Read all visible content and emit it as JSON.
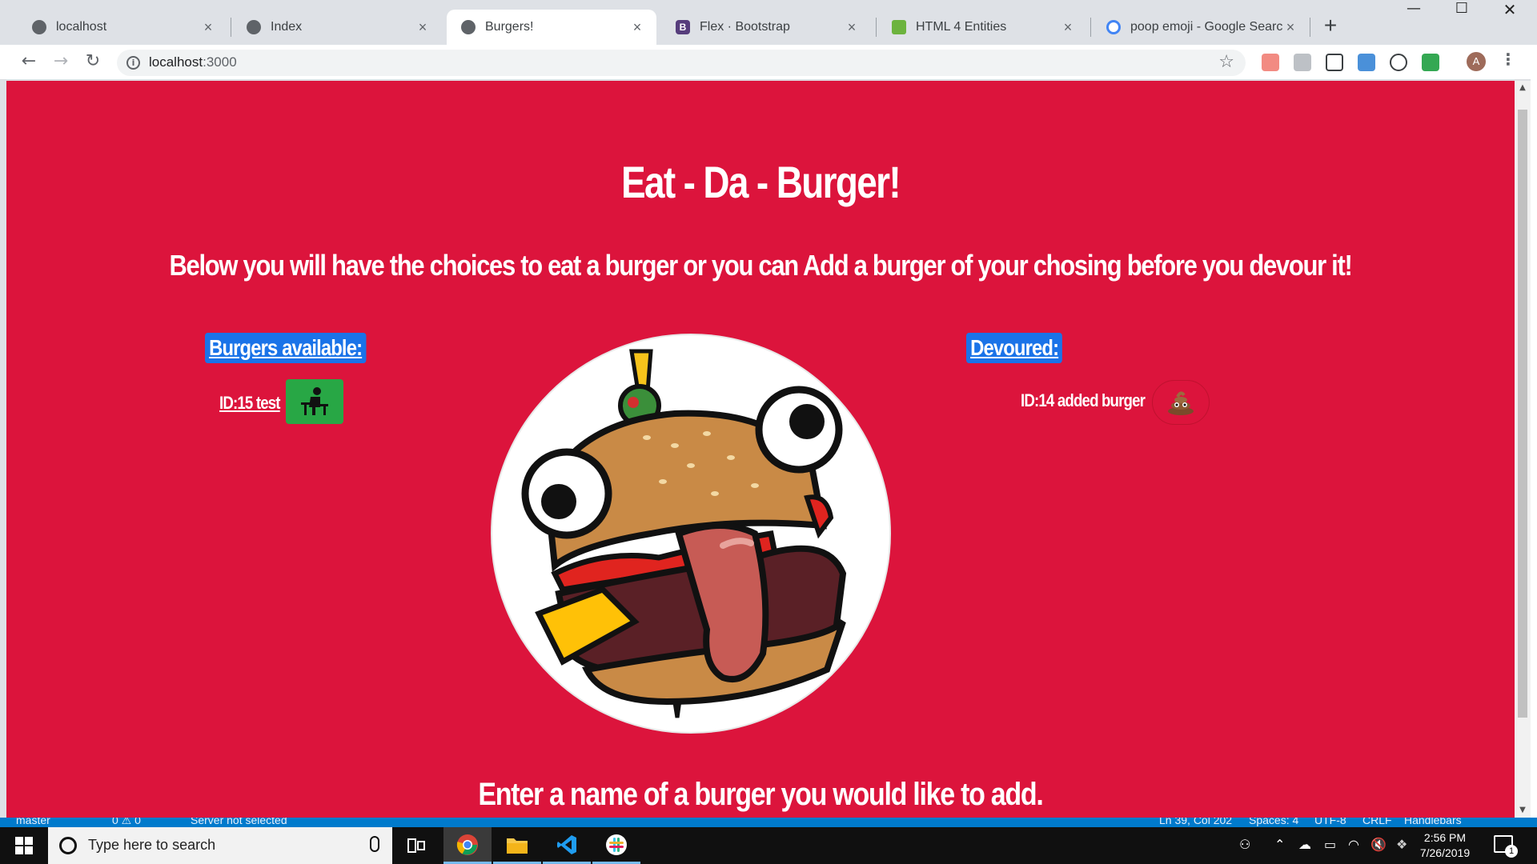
{
  "browser": {
    "tabs": [
      {
        "title": "localhost",
        "icon": "globe-icon",
        "active": false
      },
      {
        "title": "Index",
        "icon": "globe-icon",
        "active": false
      },
      {
        "title": "Burgers!",
        "icon": "globe-icon",
        "active": true
      },
      {
        "title": "Flex · Bootstrap",
        "icon": "bootstrap-icon",
        "active": false
      },
      {
        "title": "HTML 4 Entities",
        "icon": "entities-icon",
        "active": false
      },
      {
        "title": "poop emoji - Google Search",
        "icon": "google-icon",
        "active": false
      }
    ],
    "address": {
      "host": "localhost",
      "port": ":3000"
    },
    "profile_initial": "A"
  },
  "page": {
    "title": "Eat - Da - Burger!",
    "subtitle": "Below you will have the choices to eat a burger or you can Add a burger of your chosing before you devour it!",
    "available_heading": "Burgers available:",
    "devoured_heading": "Devoured:",
    "available_burgers": [
      {
        "label": "ID:15 test"
      }
    ],
    "devoured_burgers": [
      {
        "label": "ID:14 added burger"
      }
    ],
    "add_heading": "Enter a name of a burger you would like to add."
  },
  "vscode_status": {
    "branch": "master",
    "problems": "0 ⚠ 0",
    "server": "Server not selected",
    "position": "Ln 39, Col 202",
    "spaces": "Spaces: 4",
    "encoding": "UTF-8",
    "eol": "CRLF",
    "language": "Handlebars"
  },
  "taskbar": {
    "search_placeholder": "Type here to search",
    "time": "2:56 PM",
    "date": "7/26/2019",
    "notification_count": "1"
  },
  "colors": {
    "page_background": "#dc143c",
    "heading_box": "#1a73e8",
    "eat_button": "#28a745",
    "vscode_bar": "#007acc"
  }
}
